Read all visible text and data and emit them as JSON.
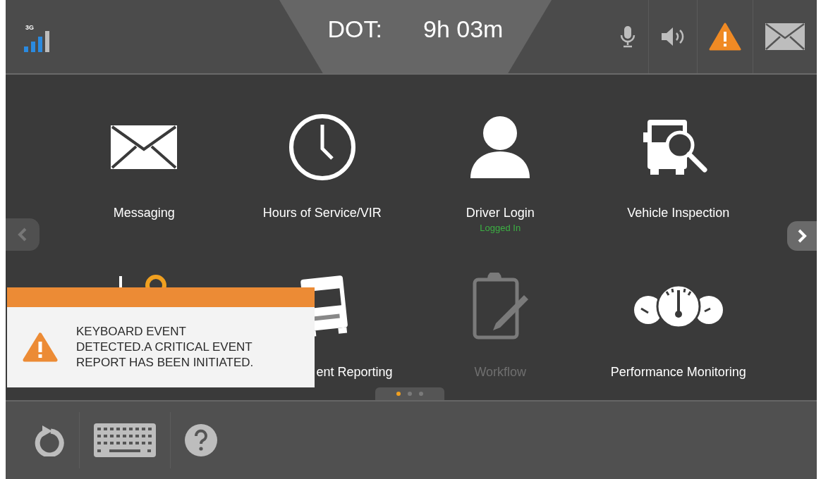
{
  "status_bar": {
    "network": "3G",
    "dot_label": "DOT:",
    "dot_time": "9h 03m",
    "icons": [
      {
        "kind": "mic"
      },
      {
        "kind": "speaker"
      },
      {
        "kind": "alert"
      },
      {
        "kind": "mail"
      }
    ]
  },
  "tiles": [
    {
      "kind": "mail",
      "label": "Messaging",
      "disabled": false
    },
    {
      "kind": "clock",
      "label": "Hours of Service/VIR",
      "disabled": false
    },
    {
      "kind": "person",
      "label": "Driver Login",
      "status": "Logged In",
      "disabled": false
    },
    {
      "kind": "inspect",
      "label": "Vehicle Inspection",
      "disabled": false
    },
    {
      "kind": "pin"
    },
    {
      "kind": "truck",
      "label": "ent Reporting",
      "cut": true,
      "disabled": false
    },
    {
      "kind": "clipboard",
      "label": "Workflow",
      "disabled": true
    },
    {
      "kind": "gauges",
      "label": "Performance Monitoring",
      "disabled": false
    }
  ],
  "pager": {
    "prev_disabled": true,
    "next_disabled": false,
    "pages": [
      {
        "selected": true
      },
      {
        "selected": false
      },
      {
        "selected": false
      }
    ]
  },
  "toast": {
    "lines": [
      "KEYBOARD EVENT",
      "DETECTED.A CRITICAL EVENT",
      "REPORT HAS BEEN INITIATED."
    ]
  },
  "toolbar": [
    {
      "kind": "refresh"
    },
    {
      "kind": "keyboard"
    },
    {
      "kind": "help"
    }
  ]
}
